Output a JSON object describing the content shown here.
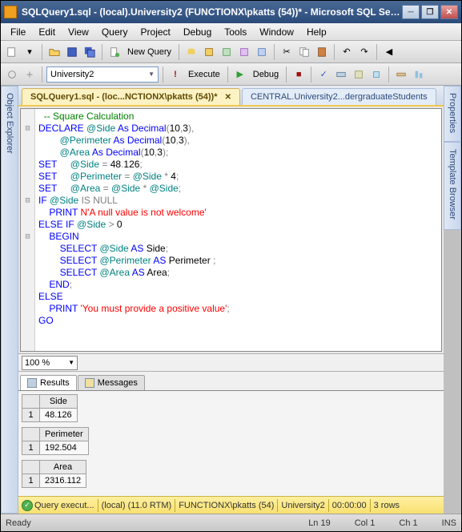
{
  "title": "SQLQuery1.sql - (local).University2 (FUNCTIONX\\pkatts (54))* - Microsoft SQL Server ...",
  "menu": [
    "File",
    "Edit",
    "View",
    "Query",
    "Project",
    "Debug",
    "Tools",
    "Window",
    "Help"
  ],
  "toolbar1": {
    "new_query": "New Query"
  },
  "toolbar2": {
    "db": "University2",
    "execute": "Execute",
    "debug": "Debug"
  },
  "side_left": "Object Explorer",
  "side_right_1": "Properties",
  "side_right_2": "Template Browser",
  "tabs": [
    {
      "label": "SQLQuery1.sql - (loc...NCTIONX\\pkatts (54))*",
      "active": true,
      "closable": true
    },
    {
      "label": "CENTRAL.University2...dergraduateStudents",
      "active": false,
      "closable": false
    }
  ],
  "code": [
    {
      "fold": "",
      "segs": [
        {
          "c": "kw-green",
          "t": "  -- Square Calculation"
        }
      ]
    },
    {
      "fold": "⊟",
      "segs": [
        {
          "c": "kw-blue",
          "t": "DECLARE"
        },
        {
          "c": "",
          "t": " "
        },
        {
          "c": "kw-teal",
          "t": "@Side"
        },
        {
          "c": "",
          "t": " "
        },
        {
          "c": "kw-blue",
          "t": "As Decimal"
        },
        {
          "c": "kw-gray",
          "t": "("
        },
        {
          "c": "",
          "t": "10"
        },
        {
          "c": "kw-gray",
          "t": ","
        },
        {
          "c": "",
          "t": "3"
        },
        {
          "c": "kw-gray",
          "t": "),"
        }
      ]
    },
    {
      "fold": "",
      "segs": [
        {
          "c": "",
          "t": "        "
        },
        {
          "c": "kw-teal",
          "t": "@Perimeter"
        },
        {
          "c": "",
          "t": " "
        },
        {
          "c": "kw-blue",
          "t": "As Decimal"
        },
        {
          "c": "kw-gray",
          "t": "("
        },
        {
          "c": "",
          "t": "10"
        },
        {
          "c": "kw-gray",
          "t": ","
        },
        {
          "c": "",
          "t": "3"
        },
        {
          "c": "kw-gray",
          "t": "),"
        }
      ]
    },
    {
      "fold": "",
      "segs": [
        {
          "c": "",
          "t": "        "
        },
        {
          "c": "kw-teal",
          "t": "@Area"
        },
        {
          "c": "",
          "t": " "
        },
        {
          "c": "kw-blue",
          "t": "As Decimal"
        },
        {
          "c": "kw-gray",
          "t": "("
        },
        {
          "c": "",
          "t": "10"
        },
        {
          "c": "kw-gray",
          "t": ","
        },
        {
          "c": "",
          "t": "3"
        },
        {
          "c": "kw-gray",
          "t": ");"
        }
      ]
    },
    {
      "fold": "",
      "segs": [
        {
          "c": "kw-blue",
          "t": "SET"
        },
        {
          "c": "",
          "t": "     "
        },
        {
          "c": "kw-teal",
          "t": "@Side"
        },
        {
          "c": "",
          "t": " "
        },
        {
          "c": "kw-gray",
          "t": "="
        },
        {
          "c": "",
          "t": " 48"
        },
        {
          "c": "kw-gray",
          "t": "."
        },
        {
          "c": "",
          "t": "126"
        },
        {
          "c": "kw-gray",
          "t": ";"
        }
      ]
    },
    {
      "fold": "",
      "segs": [
        {
          "c": "kw-blue",
          "t": "SET"
        },
        {
          "c": "",
          "t": "     "
        },
        {
          "c": "kw-teal",
          "t": "@Perimeter"
        },
        {
          "c": "",
          "t": " "
        },
        {
          "c": "kw-gray",
          "t": "="
        },
        {
          "c": "",
          "t": " "
        },
        {
          "c": "kw-teal",
          "t": "@Side"
        },
        {
          "c": "",
          "t": " "
        },
        {
          "c": "kw-gray",
          "t": "*"
        },
        {
          "c": "",
          "t": " 4"
        },
        {
          "c": "kw-gray",
          "t": ";"
        }
      ]
    },
    {
      "fold": "",
      "segs": [
        {
          "c": "kw-blue",
          "t": "SET"
        },
        {
          "c": "",
          "t": "     "
        },
        {
          "c": "kw-teal",
          "t": "@Area"
        },
        {
          "c": "",
          "t": " "
        },
        {
          "c": "kw-gray",
          "t": "="
        },
        {
          "c": "",
          "t": " "
        },
        {
          "c": "kw-teal",
          "t": "@Side"
        },
        {
          "c": "",
          "t": " "
        },
        {
          "c": "kw-gray",
          "t": "*"
        },
        {
          "c": "",
          "t": " "
        },
        {
          "c": "kw-teal",
          "t": "@Side"
        },
        {
          "c": "kw-gray",
          "t": ";"
        }
      ]
    },
    {
      "fold": "⊟",
      "segs": [
        {
          "c": "kw-blue",
          "t": "IF"
        },
        {
          "c": "",
          "t": " "
        },
        {
          "c": "kw-teal",
          "t": "@Side"
        },
        {
          "c": "",
          "t": " "
        },
        {
          "c": "kw-gray",
          "t": "IS"
        },
        {
          "c": "",
          "t": " "
        },
        {
          "c": "kw-gray",
          "t": "NULL"
        }
      ]
    },
    {
      "fold": "",
      "segs": [
        {
          "c": "",
          "t": "    "
        },
        {
          "c": "kw-blue",
          "t": "PRINT"
        },
        {
          "c": "",
          "t": " "
        },
        {
          "c": "kw-red",
          "t": "N'A null value is not welcome'"
        }
      ]
    },
    {
      "fold": "",
      "segs": [
        {
          "c": "kw-blue",
          "t": "ELSE IF"
        },
        {
          "c": "",
          "t": " "
        },
        {
          "c": "kw-teal",
          "t": "@Side"
        },
        {
          "c": "",
          "t": " "
        },
        {
          "c": "kw-gray",
          "t": ">"
        },
        {
          "c": "",
          "t": " 0"
        }
      ]
    },
    {
      "fold": "⊟",
      "segs": [
        {
          "c": "",
          "t": "    "
        },
        {
          "c": "kw-blue",
          "t": "BEGIN"
        }
      ]
    },
    {
      "fold": "",
      "segs": [
        {
          "c": "",
          "t": "        "
        },
        {
          "c": "kw-blue",
          "t": "SELECT"
        },
        {
          "c": "",
          "t": " "
        },
        {
          "c": "kw-teal",
          "t": "@Side"
        },
        {
          "c": "",
          "t": " "
        },
        {
          "c": "kw-blue",
          "t": "AS"
        },
        {
          "c": "",
          "t": " Side"
        },
        {
          "c": "kw-gray",
          "t": ";"
        }
      ]
    },
    {
      "fold": "",
      "segs": [
        {
          "c": "",
          "t": "        "
        },
        {
          "c": "kw-blue",
          "t": "SELECT"
        },
        {
          "c": "",
          "t": " "
        },
        {
          "c": "kw-teal",
          "t": "@Perimeter"
        },
        {
          "c": "",
          "t": " "
        },
        {
          "c": "kw-blue",
          "t": "AS"
        },
        {
          "c": "",
          "t": " Perimeter "
        },
        {
          "c": "kw-gray",
          "t": ";"
        }
      ]
    },
    {
      "fold": "",
      "segs": [
        {
          "c": "",
          "t": "        "
        },
        {
          "c": "kw-blue",
          "t": "SELECT"
        },
        {
          "c": "",
          "t": " "
        },
        {
          "c": "kw-teal",
          "t": "@Area"
        },
        {
          "c": "",
          "t": " "
        },
        {
          "c": "kw-blue",
          "t": "AS"
        },
        {
          "c": "",
          "t": " Area"
        },
        {
          "c": "kw-gray",
          "t": ";"
        }
      ]
    },
    {
      "fold": "",
      "segs": [
        {
          "c": "",
          "t": "    "
        },
        {
          "c": "kw-blue",
          "t": "END"
        },
        {
          "c": "kw-gray",
          "t": ";"
        }
      ]
    },
    {
      "fold": "",
      "segs": [
        {
          "c": "kw-blue",
          "t": "ELSE"
        }
      ]
    },
    {
      "fold": "",
      "segs": [
        {
          "c": "",
          "t": "    "
        },
        {
          "c": "kw-blue",
          "t": "PRINT"
        },
        {
          "c": "",
          "t": " "
        },
        {
          "c": "kw-red",
          "t": "'You must provide a positive value'"
        },
        {
          "c": "kw-gray",
          "t": ";"
        }
      ]
    },
    {
      "fold": "",
      "segs": [
        {
          "c": "kw-blue",
          "t": "GO"
        }
      ]
    }
  ],
  "zoom": "100 %",
  "result_tabs": [
    {
      "label": "Results",
      "active": true
    },
    {
      "label": "Messages",
      "active": false
    }
  ],
  "results": [
    {
      "header": "Side",
      "row": "1",
      "value": "48.126"
    },
    {
      "header": "Perimeter",
      "row": "1",
      "value": "192.504"
    },
    {
      "header": "Area",
      "row": "1",
      "value": "2316.112"
    }
  ],
  "status_yellow": {
    "msg": "Query execut...",
    "server": "(local) (11.0 RTM)",
    "user": "FUNCTIONX\\pkatts (54)",
    "db": "University2",
    "time": "00:00:00",
    "rows": "3 rows"
  },
  "statusbar": {
    "ready": "Ready",
    "ln": "Ln 19",
    "col": "Col 1",
    "ch": "Ch 1",
    "ins": "INS"
  }
}
